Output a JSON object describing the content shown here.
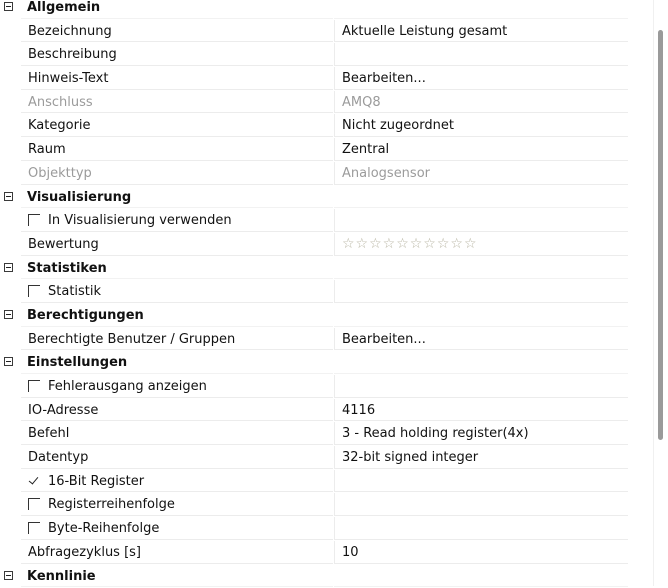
{
  "rating": {
    "stars": "☆☆☆☆☆☆☆☆☆☆"
  },
  "rows": [
    {
      "kind": "cat",
      "label": "Allgemein"
    },
    {
      "kind": "prop",
      "label": "Bezeichnung",
      "value": "Aktuelle Leistung gesamt"
    },
    {
      "kind": "prop",
      "label": "Beschreibung",
      "value": ""
    },
    {
      "kind": "prop",
      "label": "Hinweis-Text",
      "value": "Bearbeiten..."
    },
    {
      "kind": "prop",
      "label": "Anschluss",
      "value": "AMQ8",
      "disabled": true
    },
    {
      "kind": "prop",
      "label": "Kategorie",
      "value": "Nicht zugeordnet"
    },
    {
      "kind": "prop",
      "label": "Raum",
      "value": "Zentral"
    },
    {
      "kind": "prop",
      "label": "Objekttyp",
      "value": "Analogsensor",
      "disabled": true
    },
    {
      "kind": "cat",
      "label": "Visualisierung"
    },
    {
      "kind": "check",
      "label": "In Visualisierung verwenden",
      "checked": false
    },
    {
      "kind": "rating",
      "label": "Bewertung"
    },
    {
      "kind": "cat",
      "label": "Statistiken"
    },
    {
      "kind": "check",
      "label": "Statistik",
      "checked": false
    },
    {
      "kind": "cat",
      "label": "Berechtigungen"
    },
    {
      "kind": "prop",
      "label": "Berechtigte Benutzer / Gruppen",
      "value": "Bearbeiten..."
    },
    {
      "kind": "cat",
      "label": "Einstellungen"
    },
    {
      "kind": "check",
      "label": "Fehlerausgang anzeigen",
      "checked": false
    },
    {
      "kind": "prop",
      "label": "IO-Adresse",
      "value": "4116"
    },
    {
      "kind": "prop",
      "label": "Befehl",
      "value": "3 - Read holding register(4x)"
    },
    {
      "kind": "prop",
      "label": "Datentyp",
      "value": "32-bit signed integer"
    },
    {
      "kind": "check",
      "label": "16-Bit Register",
      "checked": true
    },
    {
      "kind": "check",
      "label": "Registerreihenfolge",
      "checked": false
    },
    {
      "kind": "check",
      "label": "Byte-Reihenfolge",
      "checked": false
    },
    {
      "kind": "prop",
      "label": "Abfragezyklus [s]",
      "value": "10"
    },
    {
      "kind": "cat",
      "label": "Kennlinie"
    }
  ]
}
